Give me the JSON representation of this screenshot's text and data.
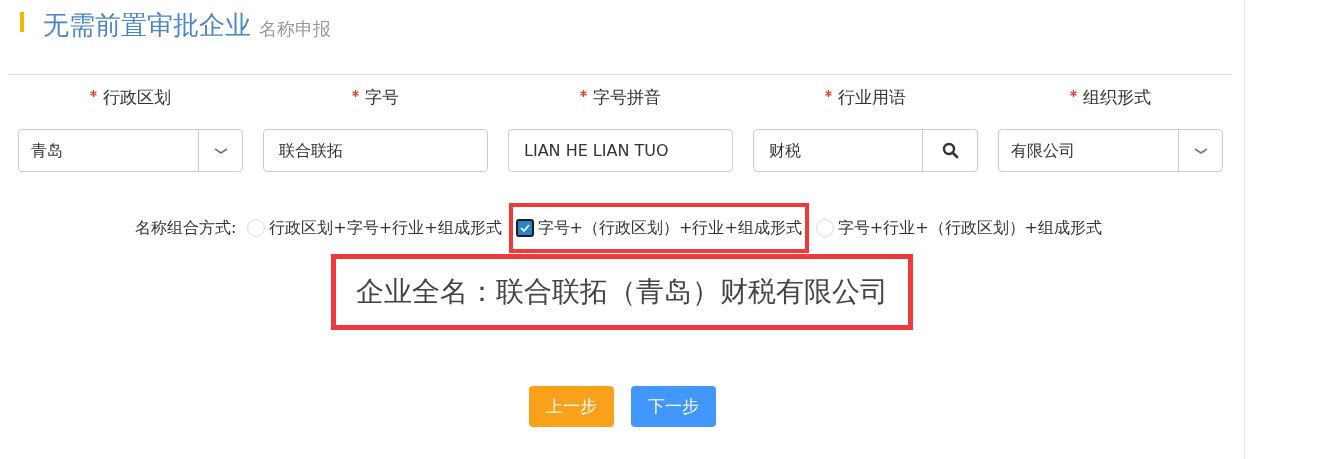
{
  "header": {
    "title": "无需前置审批企业",
    "subtitle": "名称申报"
  },
  "fields": [
    {
      "kind": "select",
      "label": "行政区划",
      "required": true,
      "value": "青岛"
    },
    {
      "kind": "input",
      "label": "字号",
      "required": true,
      "value": "联合联拓"
    },
    {
      "kind": "input",
      "label": "字号拼音",
      "required": true,
      "value": "LIAN HE LIAN TUO"
    },
    {
      "kind": "search",
      "label": "行业用语",
      "required": true,
      "value": "财税"
    },
    {
      "kind": "select",
      "label": "组织形式",
      "required": true,
      "value": "有限公司"
    }
  ],
  "combination": {
    "label": "名称组合方式:",
    "options": [
      {
        "text": "行政区划+字号+行业+组成形式",
        "selected": false,
        "highlighted": false
      },
      {
        "text": "字号+（行政区划）+行业+组成形式",
        "selected": true,
        "highlighted": true
      },
      {
        "text": "字号+行业+（行政区划）+组成形式",
        "selected": false,
        "highlighted": false
      }
    ]
  },
  "full_name": {
    "text": "企业全名：联合联拓（青岛）财税有限公司",
    "highlighted": true
  },
  "buttons": [
    {
      "kind": "prev",
      "label": "上一步"
    },
    {
      "kind": "next",
      "label": "下一步"
    }
  ]
}
